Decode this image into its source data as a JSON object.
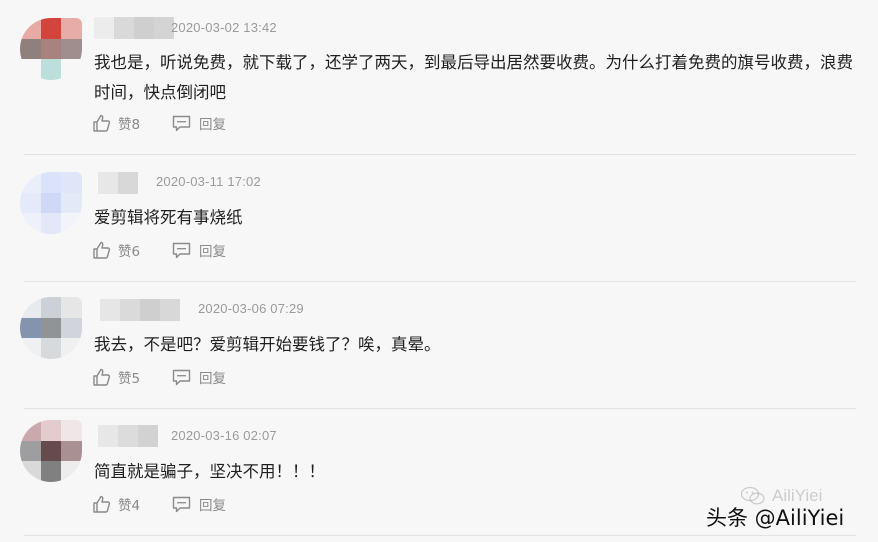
{
  "comments": [
    {
      "timestamp": "2020-03-02 13:42",
      "text": "我也是，听说免费，就下载了，还学了两天，到最后导出居然要收费。为什么打着免费的旗号收费，浪费时间，快点倒闭吧",
      "like_label": "赞8",
      "reply_label": "回复"
    },
    {
      "timestamp": "2020-03-11 17:02",
      "text": "爱剪辑将死有事烧纸",
      "like_label": "赞6",
      "reply_label": "回复"
    },
    {
      "timestamp": "2020-03-06 07:29",
      "text": "我去，不是吧？爱剪辑开始要钱了？唉，真晕。",
      "like_label": "赞5",
      "reply_label": "回复"
    },
    {
      "timestamp": "2020-03-16 02:07",
      "text": "简直就是骗子，坚决不用！！！",
      "like_label": "赞4",
      "reply_label": "回复"
    }
  ],
  "watermark": {
    "label": "头条 @AiliYiei",
    "ghost_label": "AiliYiei"
  },
  "colors": {
    "background": "#f7f7f7",
    "meta_text": "#9a9a9a",
    "divider": "#e3e3e3"
  },
  "icons": [
    "thumbs-up-icon",
    "comment-bubble-icon",
    "wechat-icon"
  ]
}
